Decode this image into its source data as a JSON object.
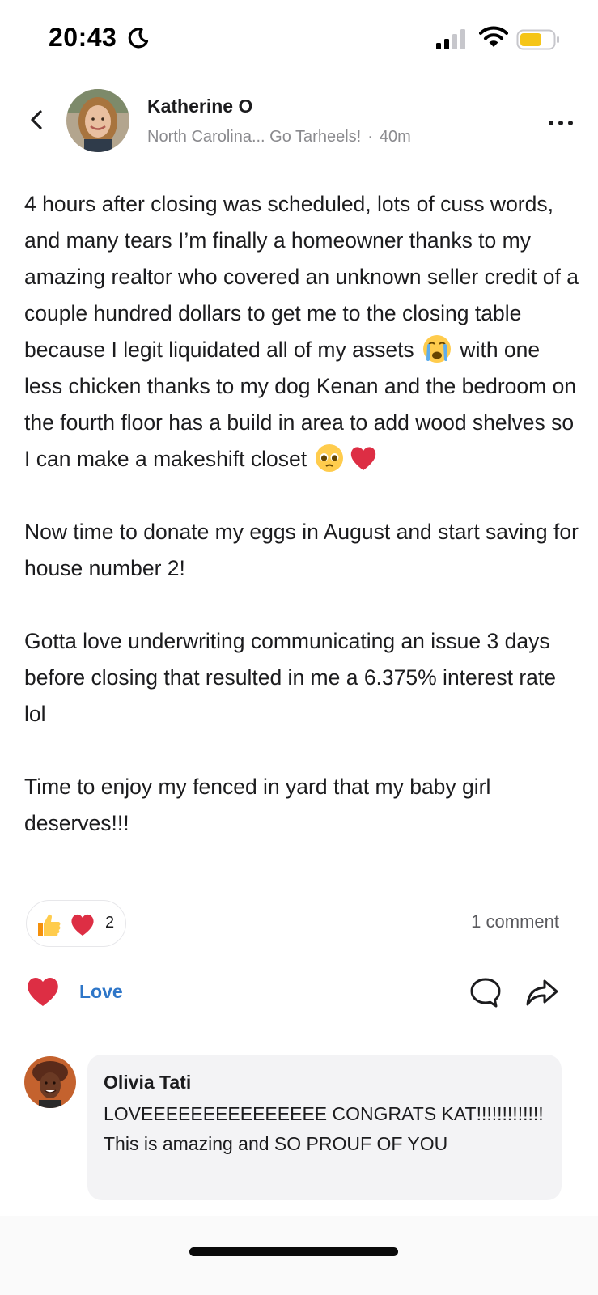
{
  "status_bar": {
    "time": "20:43",
    "icons": [
      "moon-icon",
      "signal-icon",
      "wifi-icon",
      "battery-icon"
    ],
    "battery_color": "#f5c518"
  },
  "post": {
    "author": "Katherine O",
    "location": "North Carolina... Go Tarheels!",
    "separator": "·",
    "time_ago": "40m",
    "paragraphs": {
      "p1_part1": "4 hours after closing was scheduled, lots of cuss words, and many tears I’m finally a homeowner thanks to my amazing realtor who covered an unknown seller credit of a couple hundred dollars to get me to the closing table because I legit liquidated all of my assets",
      "p1_part2": " with one less chicken thanks to my dog Kenan and the bedroom on the fourth floor has a build in area to add wood shelves so I can make a makeshift closet ",
      "p2": "Now time to donate my eggs in August and start saving for house number 2!",
      "p3": "Gotta love underwriting communicating an issue 3 days before closing that resulted in me a 6.375% interest rate lol",
      "p4": "Time to enjoy my fenced in yard that my baby girl deserves!!!"
    },
    "emojis": [
      "crying-face",
      "pleading-face",
      "red-heart"
    ]
  },
  "reactions": {
    "types": [
      "thumbs-up",
      "heart"
    ],
    "count": "2",
    "comment_count": "1 comment"
  },
  "actions": {
    "love_label": "Love",
    "love_color": "#2e76c8"
  },
  "comment": {
    "author": "Olivia Tati",
    "text": "LOVEEEEEEEEEEEEEEE CONGRATS KAT!!!!!!!!!!!!! This is amazing and SO PROUF OF YOU"
  }
}
